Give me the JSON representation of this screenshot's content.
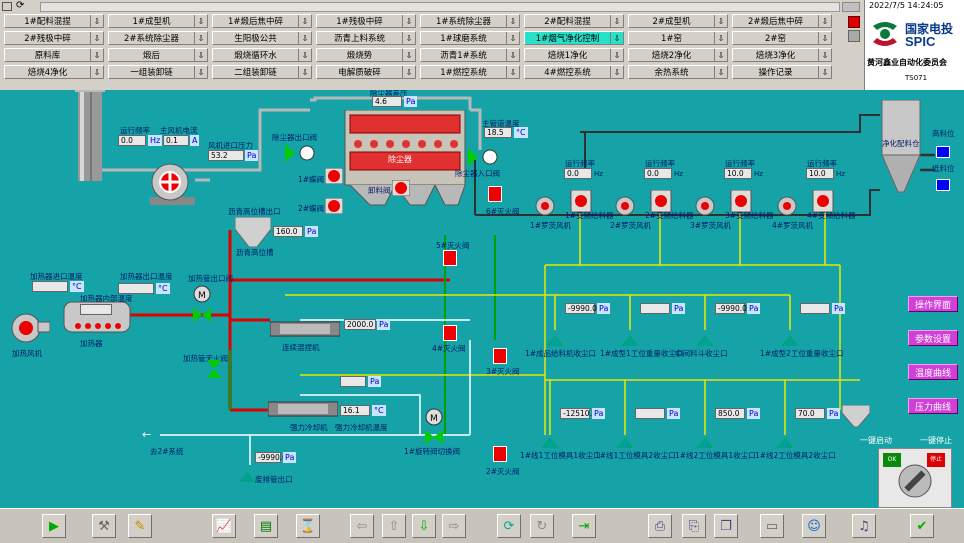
{
  "nav": {
    "row1": [
      "1#配料混捏",
      "1#成型机",
      "1#煅后焦中碎",
      "1#残极中碎",
      "1#系统除尘器",
      "2#配料混捏",
      "2#成型机",
      "2#煅后焦中碎"
    ],
    "row2": [
      "2#残极中碎",
      "2#系统除尘器",
      "生阳极公共",
      "沥青上料系统",
      "1#球磨系统",
      "1#烟气净化控制",
      "1#窑",
      "2#窑"
    ],
    "row3": [
      "原料库",
      "煅后",
      "煅烧循环水",
      "煅烧势",
      "沥青1#系统",
      "焙烧1净化",
      "焙烧2净化",
      "焙烧3净化"
    ],
    "row4": [
      "焙烧4净化",
      "一组装卸链",
      "二组装卸链",
      "电解质破碎",
      "1#燃控系统",
      "4#燃控系统",
      "余热系统",
      "操作记录"
    ],
    "active": "1#烟气净化控制"
  },
  "datetime": "2022/7/5 14:24:05",
  "logo": {
    "brand": "国家电投",
    "brand_en": "SPIC",
    "company": "黄河鑫业自动化委员会",
    "user": "TS071"
  },
  "process": {
    "dust_collector": {
      "title": "除尘器差压",
      "pressure": "4.6",
      "unit": "Pa",
      "label": "除尘器",
      "outlet_valve": "除尘器出口阀",
      "inlet_valve": "除尘器入口阀",
      "discharge": "卸料阀"
    },
    "fan": {
      "freq_label": "运行频率",
      "freq": "0.0",
      "freq_unit": "Hz",
      "current_label": "主风机电流",
      "current": "0.1",
      "current_unit": "A",
      "inlet_pressure_label": "风机进口压力",
      "inlet_pressure": "53.2",
      "inlet_unit": "Pa",
      "valve1": "1#蝶阀",
      "valve2": "2#蝶阀"
    },
    "main_pipe_temp": {
      "label": "主管道温度",
      "value": "18.5",
      "unit": "°C"
    },
    "feeders": [
      {
        "label": "1#变频给料器",
        "freq_label": "运行频率",
        "freq": "0.0",
        "unit": "Hz",
        "fan": "1#罗茨风机"
      },
      {
        "label": "2#变频给料器",
        "freq_label": "运行频率",
        "freq": "0.0",
        "unit": "Hz",
        "fan": "2#罗茨风机"
      },
      {
        "label": "3#变频给料器",
        "freq_label": "运行频率",
        "freq": "10.0",
        "unit": "Hz",
        "fan": "3#罗茨风机"
      },
      {
        "label": "4#变频给料器",
        "freq_label": "运行频率",
        "freq": "10.0",
        "unit": "Hz",
        "fan": "4#罗茨风机"
      }
    ],
    "silo": {
      "label": "净化配料仓",
      "material_high": "高料位",
      "material_low": "低料位"
    },
    "asphalt_tank": {
      "label": "沥青高位槽出口",
      "value": "160.0",
      "unit": "Pa",
      "name": "沥青高位槽"
    },
    "heater": {
      "inlet_label": "加热器进口温度",
      "inlet": "",
      "outlet_label": "加热器出口温度",
      "outlet": "",
      "inner_label": "加热器内部温度",
      "inner": "",
      "unit": "°C",
      "fan": "加热风机",
      "name": "加热器",
      "valve": "加热管出口阀",
      "bypass": "加热管无火阀"
    },
    "mixer1": {
      "label": "连续混捏机",
      "value": "2000.0",
      "unit": "Pa"
    },
    "mixer2": {
      "label": "强力冷却机",
      "temp_label": "强力冷却机温度",
      "temp": "16.1",
      "unit": "°C",
      "val_top": ""
    },
    "fire_valves": [
      "5#灭火阀",
      "3#灭火阀",
      "4#灭火阀",
      "3#灭火阀",
      "2#灭火阀"
    ],
    "fire_top": "6#灭火阀",
    "switch_valve": "1#旋转阀切换阀",
    "outlet": "去2#系统",
    "vent": {
      "label": "废排管出口",
      "value": "-9990.0",
      "unit": "Pa"
    },
    "upper_points": [
      {
        "label": "1#成品给料机收尘口",
        "value": "-9990.0",
        "unit": "Pa"
      },
      {
        "label": "1#成型1工位重量收尘口",
        "value": "",
        "unit": "Pa"
      },
      {
        "label": "中间料斗收尘口",
        "value": "-9990.0",
        "unit": "Pa"
      },
      {
        "label": "1#成型2工位重量收尘口",
        "value": "",
        "unit": "Pa"
      }
    ],
    "lower_points": [
      {
        "label": "1#线1工位模具1收尘口",
        "value": "-12510.0",
        "unit": "Pa"
      },
      {
        "label": "1#线1工位模具2收尘口",
        "value": "",
        "unit": "Pa"
      },
      {
        "label": "1#线2工位模具1收尘口",
        "value": "850.0",
        "unit": "Pa"
      },
      {
        "label": "1#线2工位模具2收尘口",
        "value": "70.0",
        "unit": "Pa"
      }
    ],
    "one_key_start": "一键启动",
    "one_key_stop": "一键停止",
    "ok_label": "OK",
    "cancel_label": "停止"
  },
  "side_buttons": [
    "操作界面",
    "参数设置",
    "温度曲线",
    "压力曲线"
  ],
  "toolbar_icons": [
    "play-icon",
    "tools-icon",
    "edit-icon",
    "chart-icon",
    "report-icon",
    "history-icon",
    "back-icon",
    "up-icon",
    "down-icon",
    "forward-icon",
    "refresh-icon",
    "redo-icon",
    "export-icon",
    "print-icon",
    "print-preview-icon",
    "copy-icon",
    "monitor-icon",
    "user-icon",
    "speaker-icon",
    "exit-icon"
  ]
}
